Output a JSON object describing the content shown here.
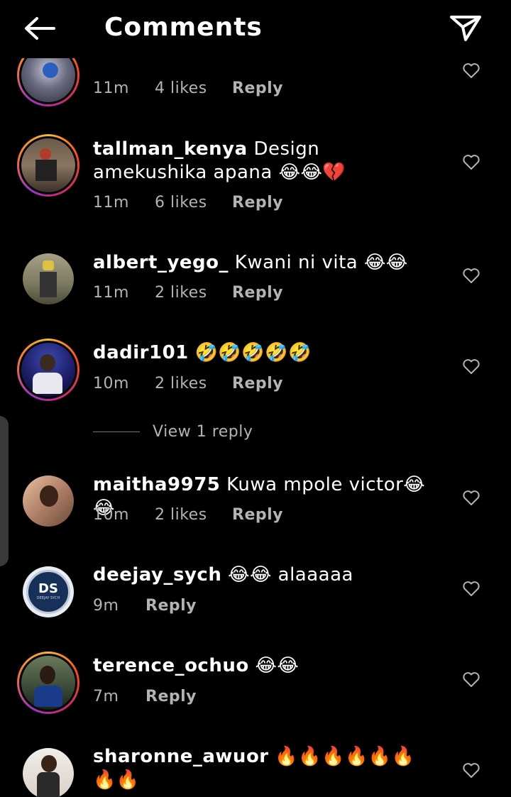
{
  "header": {
    "title": "Comments",
    "back_icon": "arrow-left-icon",
    "send_icon": "paper-plane-icon"
  },
  "colors": {
    "background": "#000000",
    "text": "#ffffff",
    "muted": "#b3b3b3",
    "story_ring": [
      "#f7b733",
      "#fc4a1a",
      "#c92a6a",
      "#a232c9"
    ]
  },
  "comments": [
    {
      "username": "",
      "text": "",
      "time": "11m",
      "likes": "4 likes",
      "reply": "Reply"
    },
    {
      "username": "tallman_kenya",
      "text": "Design amekushika apana 😂😂💔",
      "time": "11m",
      "likes": "6 likes",
      "reply": "Reply"
    },
    {
      "username": "albert_yego_",
      "text": "Kwani ni vita 😂😂",
      "time": "11m",
      "likes": "2 likes",
      "reply": "Reply"
    },
    {
      "username": "dadir101",
      "text": "🤣🤣🤣🤣🤣",
      "time": "10m",
      "likes": "2 likes",
      "reply": "Reply"
    },
    {
      "username": "maitha9975",
      "text": "Kuwa mpole victor😂😂",
      "time": "10m",
      "likes": "2 likes",
      "reply": "Reply"
    },
    {
      "username": "deejay_sych",
      "text": "😂😂 alaaaaa",
      "time": "9m",
      "likes": "",
      "reply": "Reply"
    },
    {
      "username": "terence_ochuo",
      "text": "😂😂",
      "time": "7m",
      "likes": "",
      "reply": "Reply"
    },
    {
      "username": "sharonne_awuor",
      "text": "🔥🔥🔥🔥🔥🔥🔥🔥",
      "time": "",
      "likes": "",
      "reply": ""
    }
  ],
  "view_replies": {
    "label": "View 1 reply"
  },
  "avatar_logo": {
    "text": "DS",
    "subtext": "DEEJAY SYCH"
  }
}
